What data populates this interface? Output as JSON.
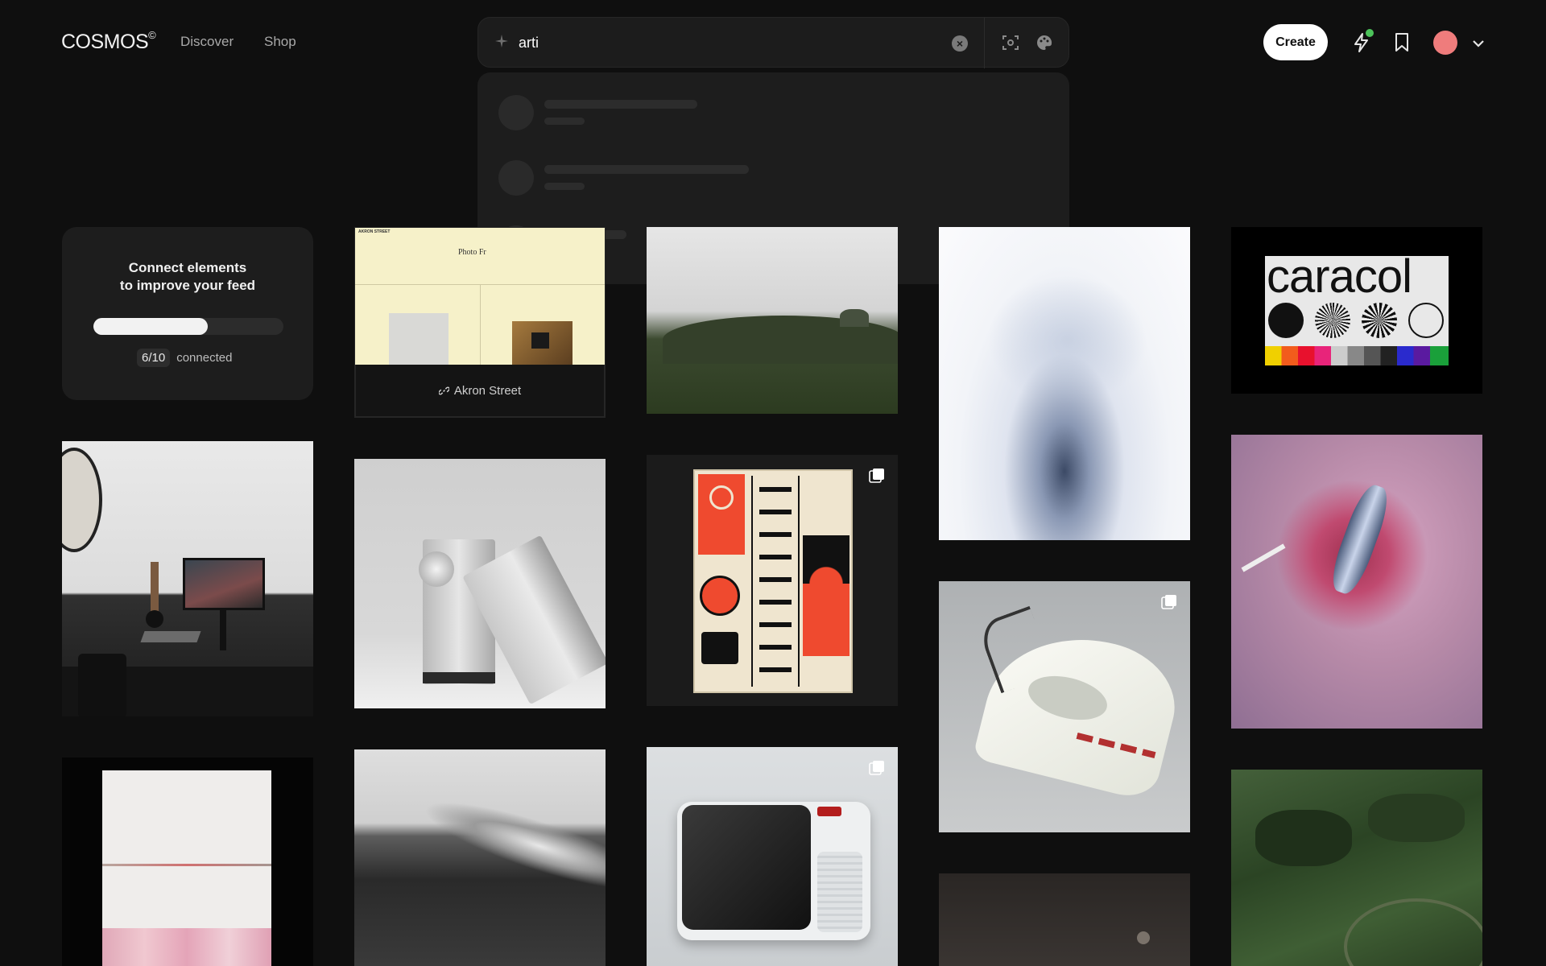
{
  "header": {
    "logo": "COSMOS",
    "logo_mark": "©",
    "nav": [
      "Discover",
      "Shop"
    ],
    "search_value": "arti",
    "create_label": "Create",
    "icons": [
      "lightning-icon",
      "bookmark-icon",
      "chevron-down-icon"
    ],
    "accent_dot_color": "#4cc35a",
    "avatar_color": "#ef7c7c"
  },
  "search_icons": [
    "sparkle-icon",
    "clear-icon",
    "visual-search-icon",
    "palette-icon"
  ],
  "connect": {
    "title_line1": "Connect elements",
    "title_line2": "to improve your feed",
    "progress": 0.6,
    "count": "6/10",
    "count_suffix": "connected"
  },
  "cards": {
    "akron_label": "Akron Street",
    "akron_header": "AKRON STREET",
    "akron_text": "Photo Fr",
    "caracol_text": "caracol"
  }
}
